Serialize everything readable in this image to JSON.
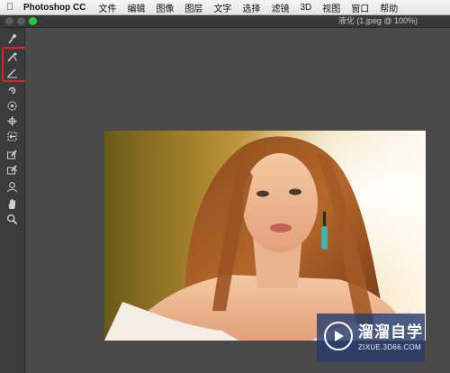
{
  "menubar": {
    "apple_icon": "apple-icon",
    "app_name": "Photoshop CC",
    "items": [
      "文件",
      "编辑",
      "图像",
      "图层",
      "文字",
      "选择",
      "滤镜",
      "3D",
      "视图",
      "窗口",
      "帮助"
    ]
  },
  "window": {
    "title": "液化 (1.jpeg @ 100%)"
  },
  "tools": [
    {
      "name": "forward-warp-tool-icon"
    },
    {
      "name": "reconstruct-tool-icon"
    },
    {
      "name": "smooth-tool-icon"
    },
    {
      "name": "twirl-clockwise-tool-icon"
    },
    {
      "name": "pucker-tool-icon"
    },
    {
      "name": "bloat-tool-icon"
    },
    {
      "name": "push-left-tool-icon"
    },
    {
      "name": "freeze-mask-tool-icon"
    },
    {
      "name": "thaw-mask-tool-icon"
    },
    {
      "name": "face-tool-icon"
    },
    {
      "name": "hand-tool-icon"
    },
    {
      "name": "zoom-tool-icon"
    }
  ],
  "watermark": {
    "brand": "溜溜自学",
    "url": "ZIXUE.3D66.COM"
  },
  "colors": {
    "highlight": "#e0202a",
    "panel": "#3b3b3b",
    "canvas": "#4a4a4a"
  }
}
